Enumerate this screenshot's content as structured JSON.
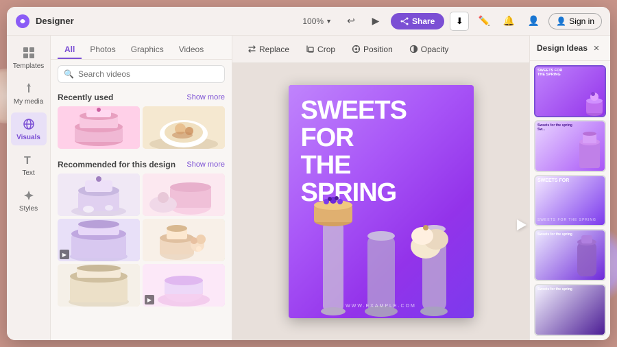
{
  "app": {
    "logo": "🎨",
    "name": "Designer",
    "zoom": "100%",
    "share_label": "Share",
    "signin_label": "Sign in"
  },
  "toolbar": {
    "replace_label": "Replace",
    "crop_label": "Crop",
    "position_label": "Position",
    "opacity_label": "Opacity"
  },
  "sidebar": {
    "items": [
      {
        "id": "templates",
        "label": "Templates",
        "icon": "⊞"
      },
      {
        "id": "media",
        "label": "My media",
        "icon": "↑"
      },
      {
        "id": "visuals",
        "label": "Visuals",
        "icon": "🌐"
      },
      {
        "id": "text",
        "label": "Text",
        "icon": "T"
      },
      {
        "id": "styles",
        "label": "Styles",
        "icon": "✦"
      }
    ]
  },
  "left_panel": {
    "tabs": [
      "All",
      "Photos",
      "Graphics",
      "Videos"
    ],
    "active_tab": "All",
    "search_placeholder": "Search videos",
    "recently_used_label": "Recently used",
    "show_more_label": "Show more",
    "recommended_label": "Recommended for this design"
  },
  "canvas": {
    "main_text_line1": "SWEETS",
    "main_text_line2": "FOR",
    "main_text_line3": "THE",
    "main_text_line4": "SPRING",
    "url_text": "WWW.EXAMPLE.COM"
  },
  "design_ideas": {
    "title": "Design Ideas",
    "items": [
      {
        "id": 1,
        "label": "Sweets for the spring",
        "bg_class": "idea-bg-1"
      },
      {
        "id": 2,
        "label": "Sweets for the spring",
        "bg_class": "idea-bg-2"
      },
      {
        "id": 3,
        "label": "SWEETS FOR",
        "bg_class": "idea-bg-3"
      },
      {
        "id": 4,
        "label": "Sweets for the spring",
        "bg_class": "idea-bg-4"
      },
      {
        "id": 5,
        "label": "Sweets for the spring",
        "bg_class": "idea-bg-5"
      }
    ]
  },
  "icons": {
    "search": "🔍",
    "close": "✕",
    "undo": "↩",
    "redo": "▶",
    "download": "⬇",
    "bell": "🔔",
    "person": "👤",
    "pen": "✏️",
    "replace": "⇄",
    "crop": "⤡",
    "position": "⊕",
    "opacity": "◉",
    "video_play": "▶"
  }
}
